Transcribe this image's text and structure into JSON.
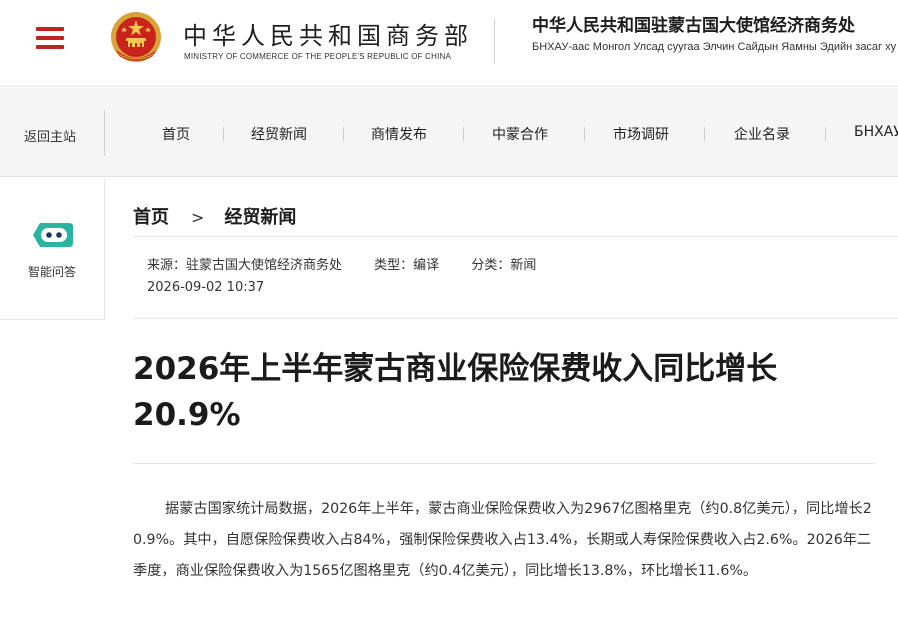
{
  "header": {
    "ministry_cn": "中华人民共和国商务部",
    "ministry_en": "MINISTRY OF COMMERCE OF THE PEOPLE'S REPUBLIC OF CHINA",
    "embassy_cn": "中华人民共和国驻蒙古国大使馆经济商务处",
    "embassy_mn": "БНХАУ-аас Монгол Улсад суугаа Элчин Сайдын Яамны Эдийн засаг ху",
    "brand_color": "#c0221f"
  },
  "nav": {
    "back_home": "返回主站",
    "items": [
      "首页",
      "经贸新闻",
      "商情发布",
      "中蒙合作",
      "市场调研",
      "企业名录",
      "БНХАУ"
    ]
  },
  "sidebar": {
    "qa_label": "智能问答",
    "icon": "robot-icon",
    "icon_color": "#2bb5a0"
  },
  "breadcrumb": {
    "home": "首页",
    "separator": ">",
    "section": "经贸新闻"
  },
  "meta": {
    "source": "来源：驻蒙古国大使馆经济商务处",
    "type": "类型：编译",
    "category": "分类：新闻",
    "date": "2026-09-02 10:37"
  },
  "article": {
    "title": "2026年上半年蒙古商业保险保费收入同比增长20.9%",
    "body": "据蒙古国家统计局数据，2026年上半年，蒙古商业保险保费收入为2967亿图格里克（约0.8亿美元），同比增长20.9%。其中，自愿保险保费收入占84%，强制保险保费收入占13.4%，长期或人寿保险保费收入占2.6%。2026年二季度，商业保险保费收入为1565亿图格里克（约0.4亿美元），同比增长13.8%，环比增长11.6%。"
  }
}
